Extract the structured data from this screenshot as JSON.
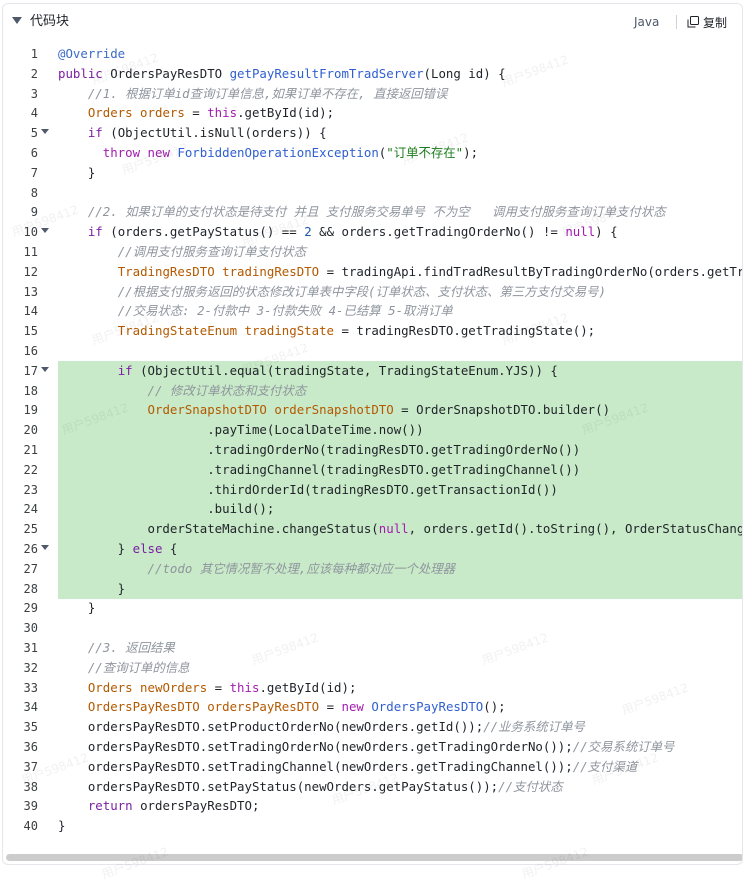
{
  "header": {
    "title": "代码块",
    "language": "Java",
    "copy_label": "复制"
  },
  "code": {
    "highlight_color": "#c8eac8",
    "lines": [
      {
        "n": "1",
        "fold": false,
        "hl": false,
        "tokens": [
          [
            "ann",
            "@Override"
          ]
        ]
      },
      {
        "n": "2",
        "fold": false,
        "hl": false,
        "tokens": [
          [
            "kw2",
            "public "
          ],
          [
            "",
            "OrdersPayResDTO "
          ],
          [
            "blue",
            "getPayResultFromTradServer"
          ],
          [
            "",
            "(Long id) {"
          ]
        ]
      },
      {
        "n": "3",
        "fold": false,
        "hl": false,
        "tokens": [
          [
            "",
            "    "
          ],
          [
            "cm",
            "//1. 根据订单id查询订单信息,如果订单不存在, 直接返回错误"
          ]
        ]
      },
      {
        "n": "4",
        "fold": false,
        "hl": false,
        "tokens": [
          [
            "",
            "    "
          ],
          [
            "orange",
            "Orders orders"
          ],
          [
            "",
            " = "
          ],
          [
            "kw",
            "this"
          ],
          [
            "",
            ".getById(id);"
          ]
        ]
      },
      {
        "n": "5",
        "fold": true,
        "hl": false,
        "tokens": [
          [
            "",
            "    "
          ],
          [
            "kw2",
            "if "
          ],
          [
            "",
            "(ObjectUtil.isNull(orders)) {"
          ]
        ]
      },
      {
        "n": "6",
        "fold": false,
        "hl": false,
        "tokens": [
          [
            "",
            "      "
          ],
          [
            "kw",
            "throw new "
          ],
          [
            "blue",
            "ForbiddenOperationException"
          ],
          [
            "",
            "("
          ],
          [
            "str",
            "\"订单不存在\""
          ],
          [
            "",
            ");"
          ]
        ]
      },
      {
        "n": "7",
        "fold": false,
        "hl": false,
        "tokens": [
          [
            "",
            "    }"
          ]
        ]
      },
      {
        "n": "8",
        "fold": false,
        "hl": false,
        "tokens": []
      },
      {
        "n": "9",
        "fold": false,
        "hl": false,
        "tokens": [
          [
            "",
            "    "
          ],
          [
            "cm",
            "//2. 如果订单的支付状态是待支付 并且 支付服务交易单号 不为空   调用支付服务查询订单支付状态"
          ]
        ]
      },
      {
        "n": "10",
        "fold": true,
        "hl": false,
        "tokens": [
          [
            "",
            "    "
          ],
          [
            "kw2",
            "if "
          ],
          [
            "",
            "(orders.getPayStatus() == "
          ],
          [
            "num",
            "2"
          ],
          [
            "",
            " && orders.getTradingOrderNo() != "
          ],
          [
            "kw",
            "null"
          ],
          [
            "",
            ") {"
          ]
        ]
      },
      {
        "n": "11",
        "fold": false,
        "hl": false,
        "tokens": [
          [
            "",
            "        "
          ],
          [
            "cm",
            "//调用支付服务查询订单支付状态"
          ]
        ]
      },
      {
        "n": "12",
        "fold": false,
        "hl": false,
        "tokens": [
          [
            "",
            "        "
          ],
          [
            "orange",
            "TradingResDTO tradingResDTO"
          ],
          [
            "",
            " = tradingApi.findTradResultByTradingOrderNo(orders.getTradingOrderNo());"
          ]
        ]
      },
      {
        "n": "13",
        "fold": false,
        "hl": false,
        "tokens": [
          [
            "",
            "        "
          ],
          [
            "cm",
            "//根据支付服务返回的状态修改订单表中字段(订单状态、支付状态、第三方支付交易号)"
          ]
        ]
      },
      {
        "n": "14",
        "fold": false,
        "hl": false,
        "tokens": [
          [
            "",
            "        "
          ],
          [
            "cm",
            "//交易状态: 2-付款中 3-付款失败 4-已结算 5-取消订单"
          ]
        ]
      },
      {
        "n": "15",
        "fold": false,
        "hl": false,
        "tokens": [
          [
            "",
            "        "
          ],
          [
            "orange",
            "TradingStateEnum tradingState"
          ],
          [
            "",
            " = tradingResDTO.getTradingState();"
          ]
        ]
      },
      {
        "n": "16",
        "fold": false,
        "hl": false,
        "tokens": []
      },
      {
        "n": "17",
        "fold": true,
        "hl": true,
        "tokens": [
          [
            "",
            "        "
          ],
          [
            "kw2",
            "if "
          ],
          [
            "",
            "(ObjectUtil.equal(tradingState, TradingStateEnum.YJS)) {"
          ]
        ]
      },
      {
        "n": "18",
        "fold": false,
        "hl": true,
        "tokens": [
          [
            "",
            "            "
          ],
          [
            "cm",
            "// 修改订单状态和支付状态"
          ]
        ]
      },
      {
        "n": "19",
        "fold": false,
        "hl": true,
        "tokens": [
          [
            "",
            "            "
          ],
          [
            "orange",
            "OrderSnapshotDTO orderSnapshotDTO"
          ],
          [
            "",
            " = OrderSnapshotDTO.builder()"
          ]
        ]
      },
      {
        "n": "20",
        "fold": false,
        "hl": true,
        "tokens": [
          [
            "",
            "                    .payTime(LocalDateTime.now())"
          ]
        ]
      },
      {
        "n": "21",
        "fold": false,
        "hl": true,
        "tokens": [
          [
            "",
            "                    .tradingOrderNo(tradingResDTO.getTradingOrderNo())"
          ]
        ]
      },
      {
        "n": "22",
        "fold": false,
        "hl": true,
        "tokens": [
          [
            "",
            "                    .tradingChannel(tradingResDTO.getTradingChannel())"
          ]
        ]
      },
      {
        "n": "23",
        "fold": false,
        "hl": true,
        "tokens": [
          [
            "",
            "                    .thirdOrderId(tradingResDTO.getTransactionId())"
          ]
        ]
      },
      {
        "n": "24",
        "fold": false,
        "hl": true,
        "tokens": [
          [
            "",
            "                    .build();"
          ]
        ]
      },
      {
        "n": "25",
        "fold": false,
        "hl": true,
        "tokens": [
          [
            "",
            "            orderStateMachine.changeStatus("
          ],
          [
            "kw",
            "null"
          ],
          [
            "",
            ", orders.getId().toString(), OrderStatusChangeEventEnum.PAYED);"
          ]
        ]
      },
      {
        "n": "26",
        "fold": true,
        "hl": true,
        "tokens": [
          [
            "",
            "        } "
          ],
          [
            "kw2",
            "else "
          ],
          [
            "",
            "{"
          ]
        ]
      },
      {
        "n": "27",
        "fold": false,
        "hl": true,
        "tokens": [
          [
            "",
            "            "
          ],
          [
            "cm",
            "//todo 其它情况暂不处理,应该每种都对应一个处理器"
          ]
        ]
      },
      {
        "n": "28",
        "fold": false,
        "hl": true,
        "tokens": [
          [
            "",
            "        }"
          ]
        ]
      },
      {
        "n": "29",
        "fold": false,
        "hl": false,
        "tokens": [
          [
            "",
            "    }"
          ]
        ]
      },
      {
        "n": "30",
        "fold": false,
        "hl": false,
        "tokens": []
      },
      {
        "n": "31",
        "fold": false,
        "hl": false,
        "tokens": [
          [
            "",
            "    "
          ],
          [
            "cm",
            "//3. 返回结果"
          ]
        ]
      },
      {
        "n": "32",
        "fold": false,
        "hl": false,
        "tokens": [
          [
            "",
            "    "
          ],
          [
            "cm",
            "//查询订单的信息"
          ]
        ]
      },
      {
        "n": "33",
        "fold": false,
        "hl": false,
        "tokens": [
          [
            "",
            "    "
          ],
          [
            "orange",
            "Orders newOrders"
          ],
          [
            "",
            " = "
          ],
          [
            "kw",
            "this"
          ],
          [
            "",
            ".getById(id);"
          ]
        ]
      },
      {
        "n": "34",
        "fold": false,
        "hl": false,
        "tokens": [
          [
            "",
            "    "
          ],
          [
            "orange",
            "OrdersPayResDTO ordersPayResDTO"
          ],
          [
            "",
            " = "
          ],
          [
            "kw",
            "new "
          ],
          [
            "blue",
            "OrdersPayResDTO"
          ],
          [
            "",
            "();"
          ]
        ]
      },
      {
        "n": "35",
        "fold": false,
        "hl": false,
        "tokens": [
          [
            "",
            "    ordersPayResDTO.setProductOrderNo(newOrders.getId());"
          ],
          [
            "cm",
            "//业务系统订单号"
          ]
        ]
      },
      {
        "n": "36",
        "fold": false,
        "hl": false,
        "tokens": [
          [
            "",
            "    ordersPayResDTO.setTradingOrderNo(newOrders.getTradingOrderNo());"
          ],
          [
            "cm",
            "//交易系统订单号"
          ]
        ]
      },
      {
        "n": "37",
        "fold": false,
        "hl": false,
        "tokens": [
          [
            "",
            "    ordersPayResDTO.setTradingChannel(newOrders.getTradingChannel());"
          ],
          [
            "cm",
            "//支付渠道"
          ]
        ]
      },
      {
        "n": "38",
        "fold": false,
        "hl": false,
        "tokens": [
          [
            "",
            "    ordersPayResDTO.setPayStatus(newOrders.getPayStatus());"
          ],
          [
            "cm",
            "//支付状态"
          ]
        ]
      },
      {
        "n": "39",
        "fold": false,
        "hl": false,
        "tokens": [
          [
            "",
            "    "
          ],
          [
            "kw2",
            "return "
          ],
          [
            "",
            "ordersPayResDTO;"
          ]
        ]
      },
      {
        "n": "40",
        "fold": false,
        "hl": false,
        "tokens": [
          [
            "",
            "}"
          ]
        ]
      }
    ]
  },
  "watermark": "用户598412"
}
